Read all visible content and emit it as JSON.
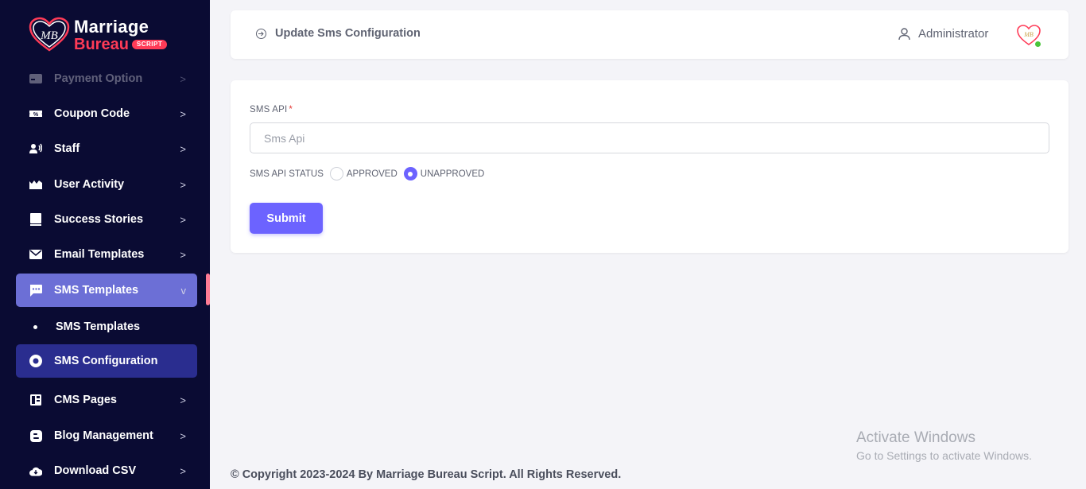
{
  "brand": {
    "line1": "Marriage",
    "line2": "Bureau",
    "badge": "SCRIPT",
    "monogram": "MB",
    "accent": "#ff3b57",
    "primary": "#6c63ff",
    "sidebar_bg": "#0a0b33"
  },
  "sidebar": {
    "items": [
      {
        "label": "Payment Option",
        "icon": "credit-card-icon"
      },
      {
        "label": "Coupon Code",
        "icon": "ticket-icon"
      },
      {
        "label": "Staff",
        "icon": "staff-icon"
      },
      {
        "label": "User Activity",
        "icon": "chart-icon"
      },
      {
        "label": "Success Stories",
        "icon": "book-icon"
      },
      {
        "label": "Email Templates",
        "icon": "envelope-icon"
      },
      {
        "label": "SMS Templates",
        "icon": "message-icon"
      },
      {
        "label": "SMS Templates",
        "icon": "dot-icon"
      },
      {
        "label": "SMS Configuration",
        "icon": "circle-dot-icon"
      },
      {
        "label": "CMS Pages",
        "icon": "layout-icon"
      },
      {
        "label": "Blog Management",
        "icon": "blog-icon"
      },
      {
        "label": "Download CSV",
        "icon": "cloud-download-icon"
      }
    ],
    "chevron_right": ">",
    "chevron_down": "v"
  },
  "header": {
    "title": "Update Sms Configuration",
    "user": "Administrator"
  },
  "form": {
    "sms_api_label": "SMS API",
    "required_mark": "*",
    "sms_api_placeholder": "Sms Api",
    "sms_api_value": "",
    "status_label": "SMS API STATUS",
    "options": [
      "APPROVED",
      "UNAPPROVED"
    ],
    "selected": "UNAPPROVED",
    "submit_label": "Submit"
  },
  "footer": {
    "copyright": "© Copyright 2023-2024 By Marriage Bureau Script. All Rights Reserved."
  },
  "watermark": {
    "title": "Activate Windows",
    "subtitle": "Go to Settings to activate Windows."
  }
}
